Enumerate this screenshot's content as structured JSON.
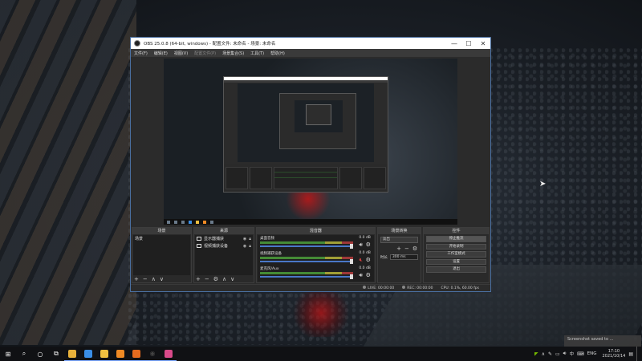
{
  "obs": {
    "title": "OBS 25.0.8 (64-bit, windows) - 配置文件: 未命名 - 场景: 未命名",
    "menu": [
      "文件(F)",
      "编辑(E)",
      "视图(V)",
      "配置文件(P)",
      "场景集合(S)",
      "工具(T)",
      "帮助(H)"
    ],
    "docks": {
      "scenes": {
        "header": "场景",
        "items": [
          "场景"
        ]
      },
      "sources": {
        "header": "来源",
        "items": [
          {
            "label": "显示器捕获",
            "icon": "monitor-icon"
          },
          {
            "label": "视频捕获设备",
            "icon": "camera-icon"
          }
        ]
      },
      "mixer": {
        "header": "混音器",
        "tracks": [
          {
            "name": "桌面音频",
            "db": "0.0 dB",
            "muted": false
          },
          {
            "name": "视频捕获设备",
            "db": "0.0 dB",
            "muted": true
          },
          {
            "name": "麦克风/Aux",
            "db": "0.0 dB",
            "muted": false
          }
        ]
      },
      "transitions": {
        "header": "场景转换",
        "selected": "淡出",
        "duration_label": "时长",
        "duration_value": "300 ms"
      },
      "controls": {
        "header": "控件",
        "buttons": [
          "停止推流",
          "开始录制",
          "工作室模式",
          "设置",
          "退出"
        ]
      }
    },
    "status": {
      "live": "LIVE: 00:00:00",
      "rec": "REC: 00:00:00",
      "cpu": "CPU: 0.1%, 60.00 fps"
    }
  },
  "notification": "Screenshot saved to ...",
  "taskbar": {
    "apps": [
      {
        "name": "start-icon",
        "glyph": "⊞",
        "color": "#ffffff"
      },
      {
        "name": "search-icon",
        "glyph": "⌕",
        "color": "#ffffff"
      },
      {
        "name": "cortana-icon",
        "glyph": "○",
        "color": "#ffffff"
      },
      {
        "name": "task-view-icon",
        "glyph": "⧉",
        "color": "#ffffff"
      },
      {
        "name": "chrome-icon",
        "glyph": "",
        "color": "#e8b13a"
      },
      {
        "name": "app-blue-icon",
        "glyph": "",
        "color": "#3a8ee6"
      },
      {
        "name": "file-explorer-icon",
        "glyph": "",
        "color": "#f0c040"
      },
      {
        "name": "app-orange-icon",
        "glyph": "",
        "color": "#f08a24"
      },
      {
        "name": "app-orange2-icon",
        "glyph": "",
        "color": "#e56b1f"
      },
      {
        "name": "obs-icon",
        "glyph": "◉",
        "color": "#444444"
      },
      {
        "name": "app-pink-icon",
        "glyph": "",
        "color": "#d94a8a"
      }
    ],
    "tray": {
      "lang": "ENG",
      "ime": "中",
      "time": "17:10",
      "date": "2021/10/14"
    }
  }
}
